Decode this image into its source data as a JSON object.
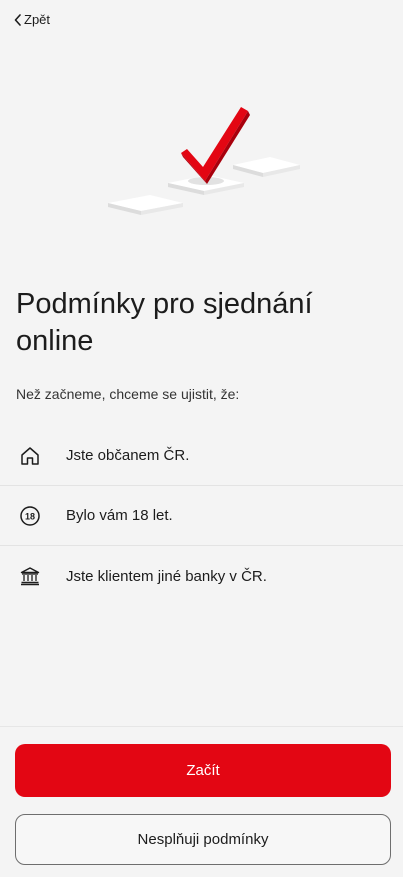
{
  "nav": {
    "back_label": "Zpět"
  },
  "page": {
    "title": "Podmínky pro sjednání online",
    "subtitle": "Než začneme, chceme se ujistit, že:"
  },
  "conditions": [
    {
      "icon": "home-icon",
      "label": "Jste občanem ČR."
    },
    {
      "icon": "age-18-icon",
      "icon_text": "18",
      "label": "Bylo vám 18 let."
    },
    {
      "icon": "bank-icon",
      "label": "Jste klientem jiné banky v ČR."
    }
  ],
  "actions": {
    "start_label": "Začít",
    "decline_label": "Nesplňuji podmínky"
  },
  "colors": {
    "accent": "#e30613",
    "background": "#f4f4f4"
  }
}
